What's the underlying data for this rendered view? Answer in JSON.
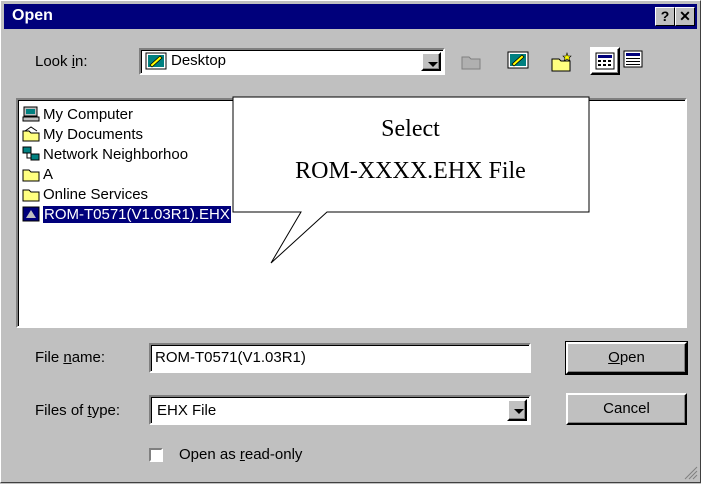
{
  "window": {
    "title": "Open"
  },
  "title_buttons": {
    "help": "?",
    "close": "✕"
  },
  "lookin": {
    "label_pre": "Look ",
    "label_key": "i",
    "label_post": "n:",
    "value": "Desktop"
  },
  "toolbar": {
    "icons": [
      "up-folder-icon",
      "desktop-icon",
      "new-folder-icon",
      "list-view-icon",
      "details-view-icon"
    ]
  },
  "files": [
    {
      "label": "My Computer",
      "icon": "computer-icon"
    },
    {
      "label": "My Documents",
      "icon": "documents-icon"
    },
    {
      "label": "Network Neighborhoo",
      "icon": "network-icon"
    },
    {
      "label": "A",
      "icon": "folder-icon"
    },
    {
      "label": "Online Services",
      "icon": "folder-icon"
    },
    {
      "label": "ROM-T0571(V1.03R1).EHX",
      "icon": "ehx-file-icon",
      "selected": true
    }
  ],
  "callout": {
    "line1": "Select",
    "line2": "ROM-XXXX.EHX File"
  },
  "filename": {
    "label_pre": "File ",
    "label_key": "n",
    "label_post": "ame:",
    "value": "ROM-T0571(V1.03R1)"
  },
  "filetype": {
    "label_pre": "Files of ",
    "label_key": "t",
    "label_post": "ype:",
    "value": "EHX File"
  },
  "buttons": {
    "open_key": "O",
    "open_rest": "pen",
    "cancel": "Cancel"
  },
  "readonly": {
    "label_pre": "Open as ",
    "label_key": "r",
    "label_post": "ead-only",
    "checked": false
  }
}
